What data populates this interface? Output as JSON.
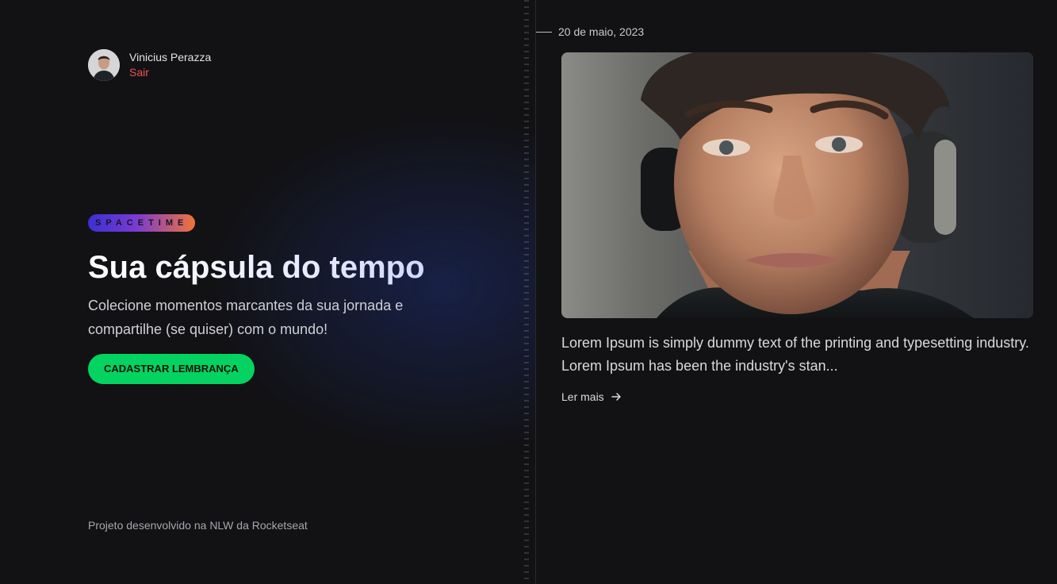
{
  "user": {
    "name": "Vinicius Perazza",
    "logout_label": "Sair",
    "avatar_icon": "avatar-photo"
  },
  "hero": {
    "brand": "SPACETIME",
    "title": "Sua cápsula do tempo",
    "subtitle": "Colecione momentos marcantes da sua jornada e compartilhe (se quiser) com o mundo!",
    "cta_label": "CADASTRAR LEMBRANÇA"
  },
  "footer": {
    "text": "Projeto desenvolvido na NLW da Rocketseat"
  },
  "memory": {
    "date": "20 de maio, 2023",
    "image_icon": "memory-photo",
    "excerpt": "Lorem Ipsum is simply dummy text of the printing and typesetting industry. Lorem Ipsum has been the industry's stan...",
    "read_more_label": "Ler mais",
    "read_more_icon": "arrow-right-icon"
  },
  "colors": {
    "background": "#121215",
    "accent_green": "#04d361",
    "logout_red": "#ef5350",
    "brand_gradient_start": "#3b30d4",
    "brand_gradient_end": "#f0733a"
  }
}
